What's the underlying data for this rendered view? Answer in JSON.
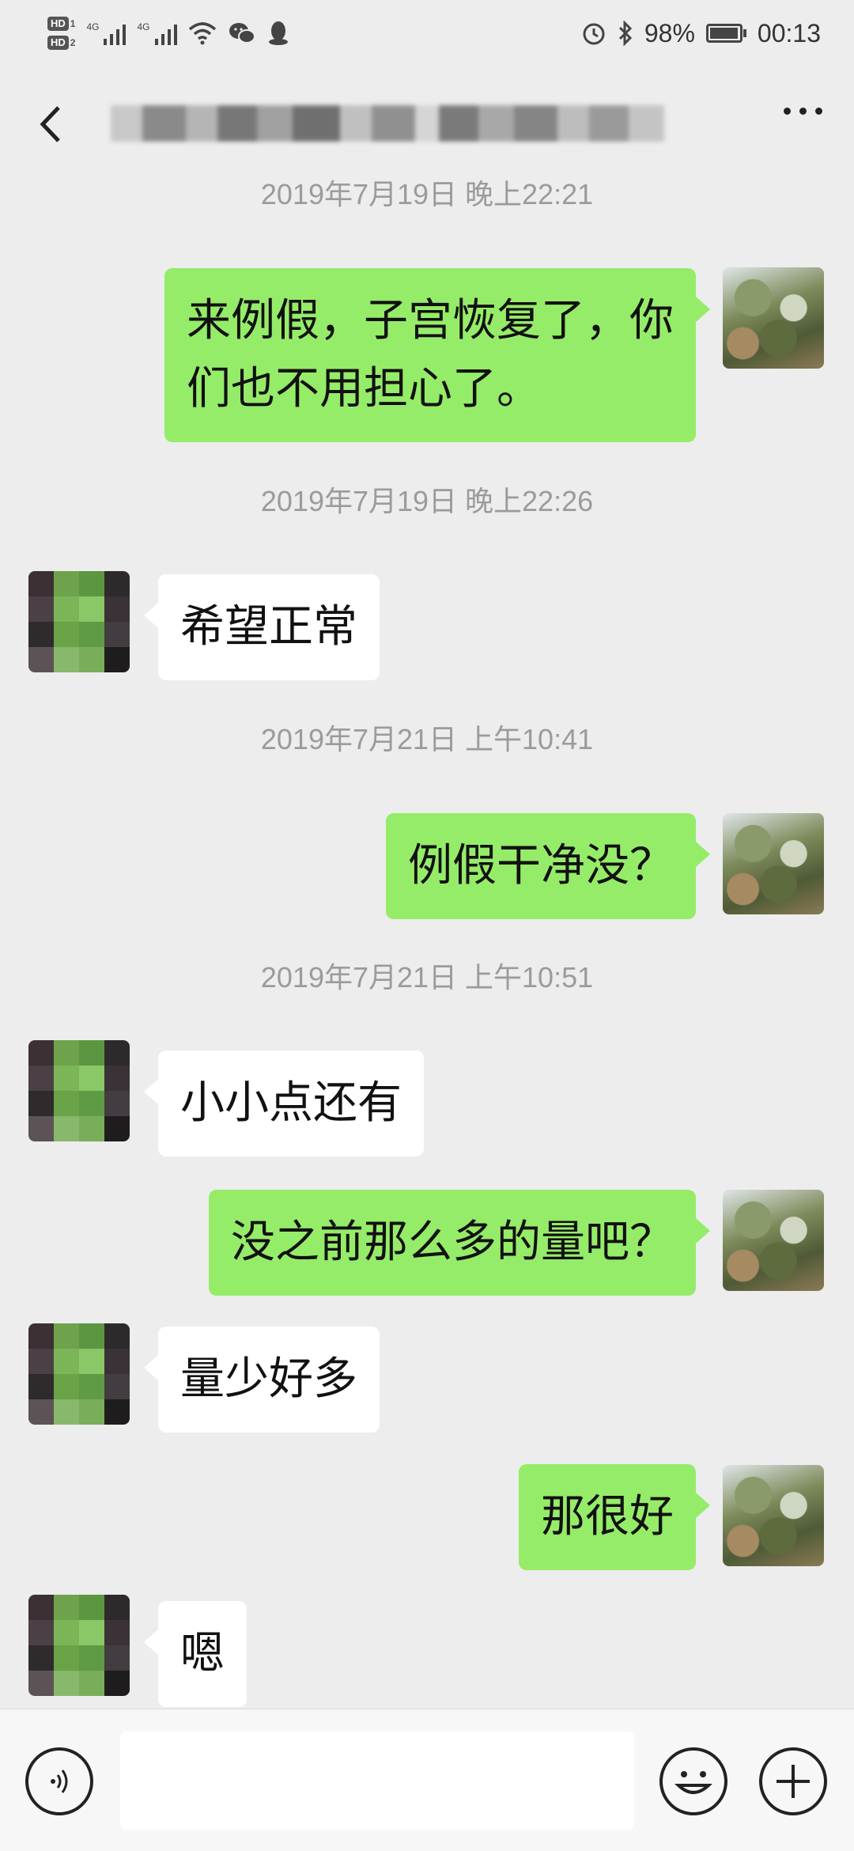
{
  "status_bar": {
    "hd1": "HD",
    "hd1_num": "1",
    "hd2": "HD",
    "hd2_num": "2",
    "signal1_tag": "4G",
    "signal2_tag": "4G",
    "battery_percent_text": "98%",
    "battery_level": 0.98,
    "time": "00:13",
    "icons": [
      "hd-icon",
      "signal-icon",
      "signal-icon",
      "wifi-icon",
      "wechat-icon",
      "qq-icon",
      "alarm-icon",
      "bluetooth-icon",
      "battery-icon"
    ]
  },
  "header": {
    "title_blurred": true,
    "back_icon": "chevron-left-icon",
    "more_icon": "more-icon"
  },
  "messages": [
    {
      "type": "timestamp",
      "text": "2019年7月19日 晚上22:21"
    },
    {
      "type": "bubble",
      "sender": "me",
      "lines": [
        "来例假，子宫恢复了，你",
        "们也不用担心了。"
      ]
    },
    {
      "type": "timestamp",
      "text": "2019年7月19日 晚上22:26"
    },
    {
      "type": "bubble",
      "sender": "them",
      "lines": [
        "希望正常"
      ]
    },
    {
      "type": "timestamp",
      "text": "2019年7月21日 上午10:41"
    },
    {
      "type": "bubble",
      "sender": "me",
      "lines": [
        "例假干净没？"
      ]
    },
    {
      "type": "timestamp",
      "text": "2019年7月21日 上午10:51"
    },
    {
      "type": "bubble",
      "sender": "them",
      "lines": [
        "小小点还有"
      ]
    },
    {
      "type": "bubble",
      "sender": "me",
      "lines": [
        "没之前那么多的量吧？"
      ]
    },
    {
      "type": "bubble",
      "sender": "them",
      "lines": [
        "量少好多"
      ]
    },
    {
      "type": "bubble",
      "sender": "me",
      "lines": [
        "那很好"
      ]
    },
    {
      "type": "bubble",
      "sender": "them",
      "lines": [
        "嗯"
      ]
    }
  ],
  "input_bar": {
    "voice_icon": "voice-icon",
    "emoji_icon": "emoji-icon",
    "plus_icon": "plus-icon",
    "text_value": ""
  },
  "colors": {
    "background": "#ededed",
    "my_bubble": "#95ec69",
    "their_bubble": "#ffffff",
    "timestamp": "#9b9b9b"
  }
}
